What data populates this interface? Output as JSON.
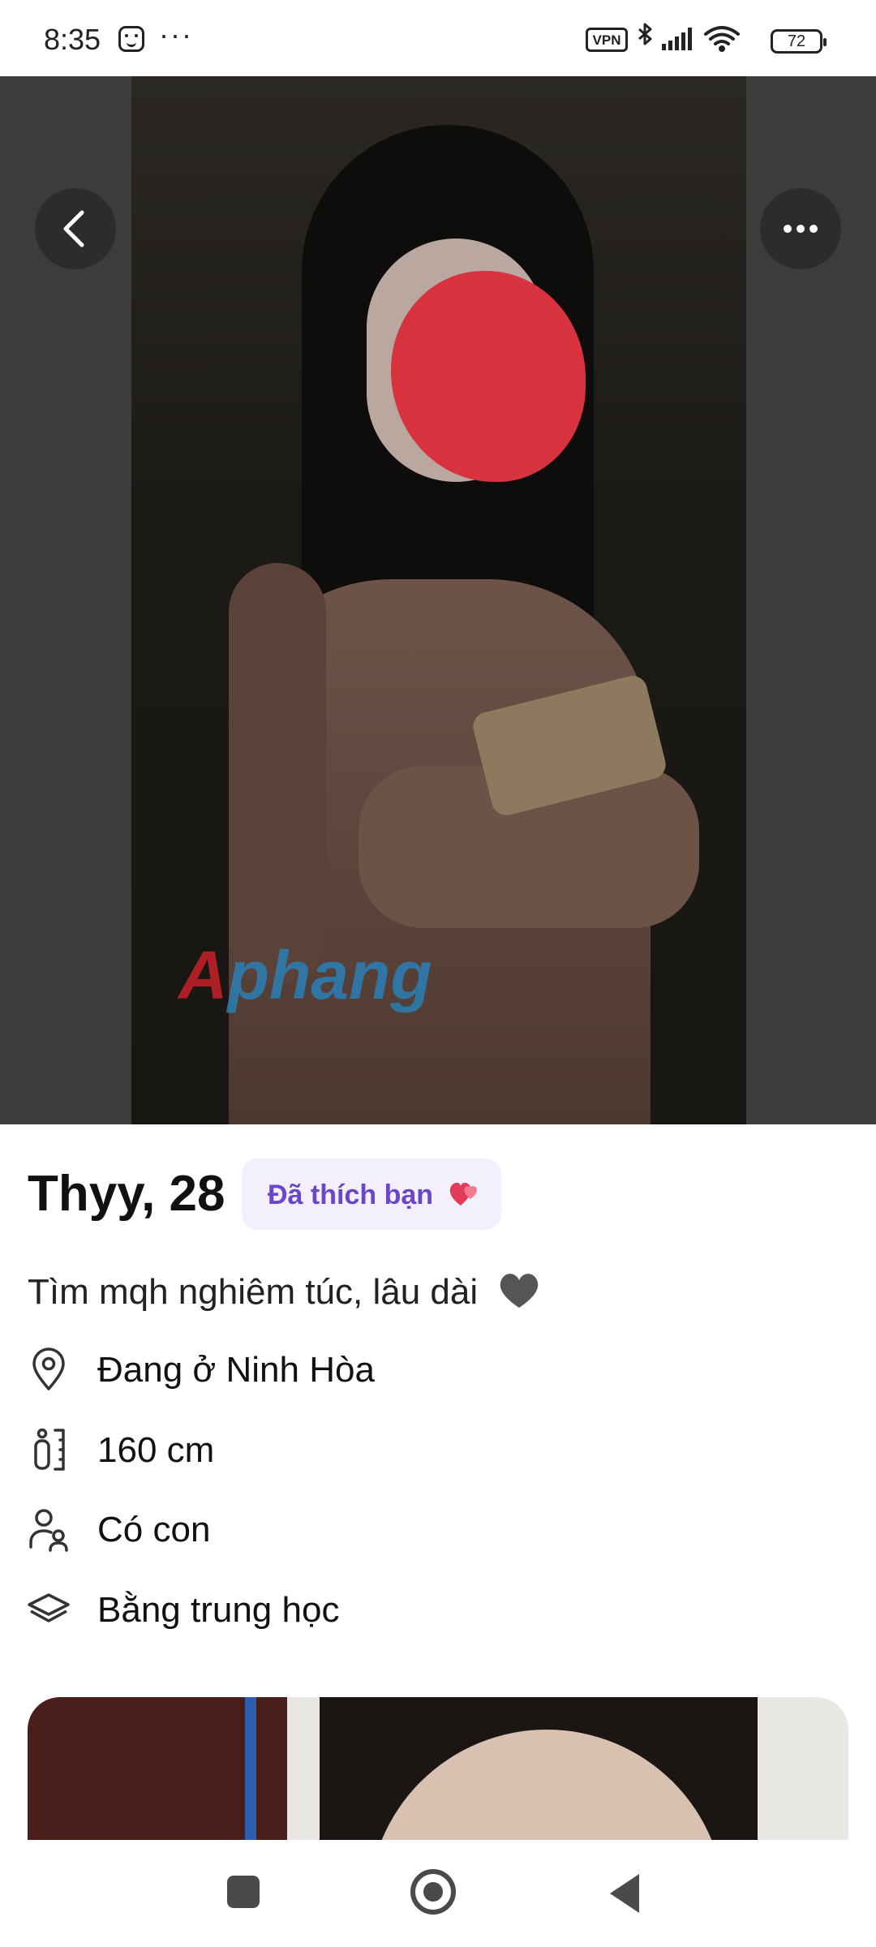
{
  "status_bar": {
    "time": "8:35",
    "more": "···",
    "vpn": "VPN",
    "battery": "72"
  },
  "photo": {
    "watermark_a": "A",
    "watermark_rest": "phang"
  },
  "profile": {
    "name_age": "Thyy, 28",
    "liked_badge": "Đã thích bạn",
    "bio": "Tìm mqh nghiêm túc, lâu dài",
    "location": "Đang ở Ninh Hòa",
    "height": "160 cm",
    "children": "Có con",
    "education": "Bằng trung học"
  },
  "icons": {
    "back": "chevron-left-icon",
    "more": "more-horizontal-icon",
    "location": "location-pin-icon",
    "height": "height-icon",
    "children": "family-icon",
    "education": "graduation-cap-icon",
    "heart_badge": "hearts-icon",
    "bio_heart": "grey-heart-icon"
  },
  "colors": {
    "badge_bg": "#f3effd",
    "badge_text": "#6a47c9",
    "accent_heart": "#e23b5a"
  }
}
